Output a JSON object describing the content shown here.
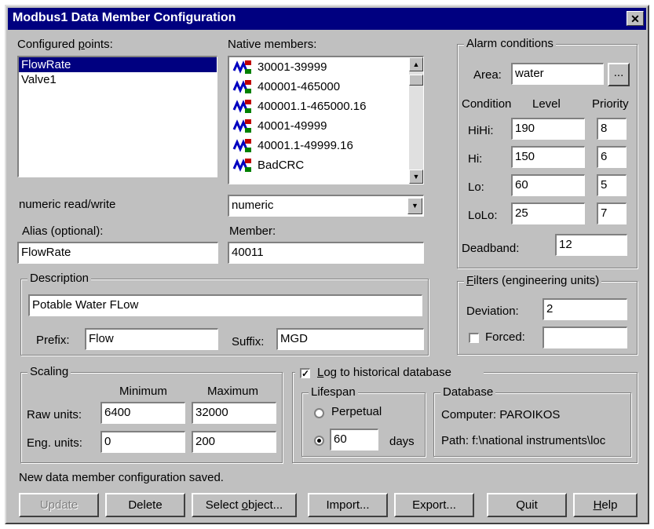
{
  "window": {
    "title": "Modbus1 Data Member Configuration",
    "close_label": "✕"
  },
  "configured_points": {
    "label": "Configured points:",
    "items": [
      "FlowRate",
      "Valve1"
    ],
    "selected": "FlowRate"
  },
  "native_members": {
    "label": "Native members:",
    "items": [
      "30001-39999",
      "400001-465000",
      "400001.1-465000.16",
      "40001-49999",
      "40001.1-49999.16",
      "BadCRC"
    ]
  },
  "type_text": "numeric read/write",
  "type_select": {
    "value": "numeric",
    "arrow": "▼"
  },
  "alias": {
    "label": "Alias (optional):",
    "value": "FlowRate"
  },
  "member": {
    "label": "Member:",
    "value": "40011"
  },
  "description": {
    "group_label": "Description",
    "value": "Potable Water FLow",
    "prefix_label": "Prefix:",
    "prefix_value": "Flow",
    "suffix_label": "Suffix:",
    "suffix_value": "MGD"
  },
  "alarm": {
    "group_label": "Alarm conditions",
    "area_label": "Area:",
    "area_value": "water",
    "browse_label": "...",
    "col_condition": "Condition",
    "col_level": "Level",
    "col_priority": "Priority",
    "rows": [
      {
        "label": "HiHi:",
        "level": "190",
        "priority": "8"
      },
      {
        "label": "Hi:",
        "level": "150",
        "priority": "6"
      },
      {
        "label": "Lo:",
        "level": "60",
        "priority": "5"
      },
      {
        "label": "LoLo:",
        "level": "25",
        "priority": "7"
      }
    ],
    "deadband_label": "Deadband:",
    "deadband_value": "12"
  },
  "filters": {
    "group_label": "Filters (engineering units)",
    "deviation_label": "Deviation:",
    "deviation_value": "2",
    "forced_label": "Forced:",
    "forced_checked": false,
    "forced_value": ""
  },
  "scaling": {
    "group_label": "Scaling",
    "min_label": "Minimum",
    "max_label": "Maximum",
    "raw_label": "Raw units:",
    "raw_min": "6400",
    "raw_max": "32000",
    "eng_label": "Eng. units:",
    "eng_min": "0",
    "eng_max": "200"
  },
  "historical": {
    "log_label": "Log to historical database",
    "log_checked": true,
    "lifespan_label": "Lifespan",
    "perpetual_label": "Perpetual",
    "days_value": "60",
    "days_label": "days",
    "database_label": "Database",
    "computer": "Computer: PAROIKOS",
    "path": "Path: f:\\national instruments\\loc"
  },
  "status": "New data member configuration saved.",
  "buttons": {
    "update": "Update",
    "delete": "Delete",
    "select_object": "Select object...",
    "import": "Import...",
    "export": "Export...",
    "quit": "Quit",
    "help": "Help"
  },
  "colors": {
    "title_bar": "#000080",
    "face": "#c0c0c0",
    "selection": "#000080"
  }
}
